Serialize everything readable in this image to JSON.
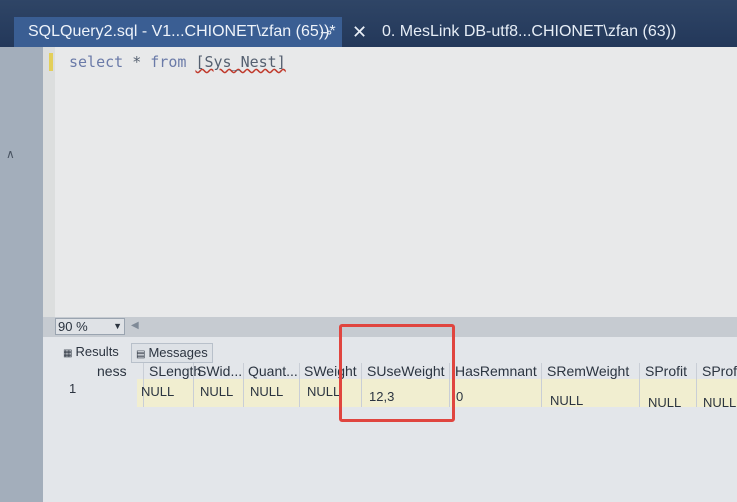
{
  "tabs": {
    "active_title": "SQLQuery2.sql - V1...CHIONET\\zfan (65))*",
    "pin_icon": "pin-icon",
    "inactive_close": "✕",
    "inactive_title": "0. MesLink DB-utf8...CHIONET\\zfan (63))"
  },
  "editor": {
    "kw_select": "select",
    "star": " * ",
    "kw_from": "from",
    "space": " ",
    "table": "[Sys_Nest]"
  },
  "status": {
    "zoom": "90 %"
  },
  "results_tabs": {
    "results": "Results",
    "messages": "Messages"
  },
  "grid": {
    "row_number": "1",
    "columns": [
      {
        "header": "ness",
        "value": ""
      },
      {
        "header": "SLength",
        "value": "NULL"
      },
      {
        "header": "SWid...",
        "value": "NULL"
      },
      {
        "header": "Quant...",
        "value": "NULL"
      },
      {
        "header": "SWeight",
        "value": "NULL"
      },
      {
        "header": "SUseWeight",
        "value": "12,3"
      },
      {
        "header": "HasRemnant",
        "value": "0"
      },
      {
        "header": "SRemWeight",
        "value": "NULL"
      },
      {
        "header": "SProfit",
        "value": "NULL"
      },
      {
        "header": "SProf",
        "value": "NULL"
      }
    ]
  }
}
